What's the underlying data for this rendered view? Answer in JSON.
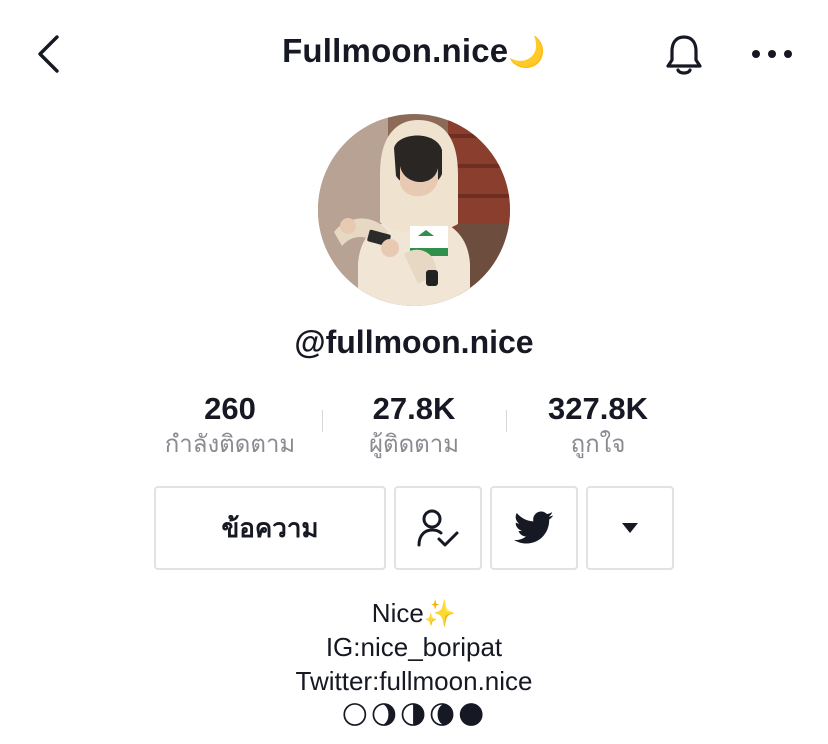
{
  "header": {
    "title": "Fullmoon.nice",
    "title_emoji": "🌙",
    "back_icon": "chevron-left-icon",
    "bell_icon": "bell-icon",
    "more_icon": "more-horizontal-icon"
  },
  "profile": {
    "handle": "@fullmoon.nice",
    "avatar": "avatar-photo"
  },
  "stats": [
    {
      "value": "260",
      "label": "กำลังติดตาม"
    },
    {
      "value": "27.8K",
      "label": "ผู้ติดตาม"
    },
    {
      "value": "327.8K",
      "label": "ถูกใจ"
    }
  ],
  "actions": {
    "message_label": "ข้อความ",
    "following_icon": "user-check-icon",
    "twitter_icon": "twitter-icon",
    "dropdown_icon": "caret-down-icon"
  },
  "bio": {
    "line1": "Nice",
    "line1_emoji": "✨",
    "line2": "IG:nice_boripat",
    "line3": "Twitter:fullmoon.nice",
    "line4": "🌕🌖🌗🌘🌑"
  },
  "colors": {
    "text": "#161823",
    "muted": "#8a8b91",
    "border": "#e2e2e4",
    "moon": "#f5c84c"
  }
}
